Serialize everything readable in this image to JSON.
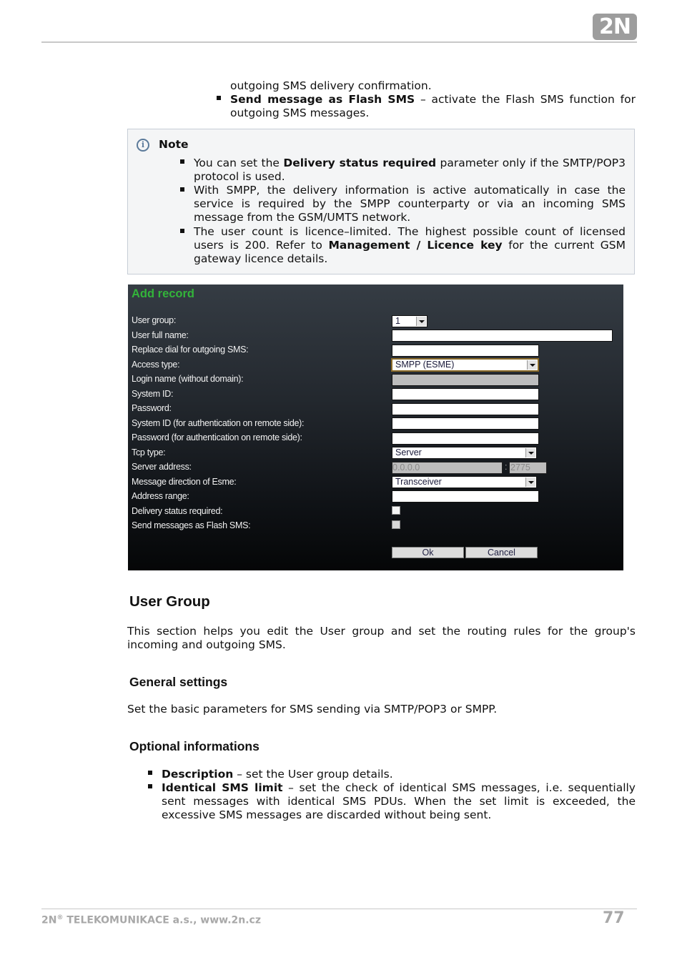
{
  "header": {
    "logo_text": "2N"
  },
  "intro": {
    "continuation": "outgoing SMS delivery confirmation.",
    "bullet_bold": "Send message as Flash SMS",
    "bullet_rest": " – activate the Flash SMS function for outgoing SMS messages."
  },
  "note": {
    "title": "Note",
    "icon": "info-icon",
    "items": [
      {
        "pre": "You can set the ",
        "bold": "Delivery status required",
        "post": " parameter only if the SMTP/POP3 protocol is used."
      },
      {
        "pre": "With SMPP, the delivery information is active automatically in case the service is required by the SMPP counterparty or via an incoming SMS message from the GSM/UMTS network.",
        "bold": "",
        "post": ""
      },
      {
        "pre": "The user count is licence–limited. The highest possible count of licensed users is 200. Refer to ",
        "bold": "Management / Licence key",
        "post": " for the current GSM gateway licence details."
      }
    ]
  },
  "form": {
    "title": "Add record",
    "accent_color": "#33b43a",
    "fields": {
      "user_group": {
        "label": "User group:",
        "value": "1"
      },
      "user_full_name": {
        "label": "User full name:",
        "value": ""
      },
      "replace_dial": {
        "label": "Replace dial for outgoing SMS:",
        "value": ""
      },
      "access_type": {
        "label": "Access type:",
        "value": "SMPP (ESME)"
      },
      "login_name": {
        "label": "Login name (without domain):",
        "value": ""
      },
      "system_id": {
        "label": "System ID:",
        "value": ""
      },
      "password": {
        "label": "Password:",
        "value": ""
      },
      "system_id_remote": {
        "label": "System ID (for authentication on remote side):",
        "value": ""
      },
      "password_remote": {
        "label": "Password (for authentication on remote side):",
        "value": ""
      },
      "tcp_type": {
        "label": "Tcp type:",
        "value": "Server"
      },
      "server_address": {
        "label": "Server address:",
        "ip": "0.0.0.0",
        "separator": ":",
        "port": "2775"
      },
      "message_direction": {
        "label": "Message direction of Esme:",
        "value": "Transceiver"
      },
      "address_range": {
        "label": "Address range:",
        "value": ""
      },
      "delivery_status": {
        "label": "Delivery status required:",
        "checked": false
      },
      "flash_sms": {
        "label": "Send messages as Flash SMS:",
        "checked": false
      }
    },
    "buttons": {
      "ok": "Ok",
      "cancel": "Cancel"
    }
  },
  "user_group": {
    "heading": "User Group",
    "description": "This section helps you edit the User group and set the routing rules for the group's incoming and outgoing SMS."
  },
  "general_settings": {
    "heading": "General settings",
    "text": "Set the basic parameters for SMS sending via SMTP/POP3 or SMPP."
  },
  "optional_informations": {
    "heading": "Optional informations",
    "items": [
      {
        "bold": "Description",
        "rest": " – set the User group details."
      },
      {
        "bold": "Identical SMS limit",
        "rest": " – set the check of identical SMS messages, i.e. sequentially sent messages with identical SMS PDUs. When the set limit is exceeded, the excessive SMS messages are discarded without being sent."
      }
    ]
  },
  "footer": {
    "company": "2N",
    "registered": "®",
    "company_rest": " TELEKOMUNIKACE a.s., www.2n.cz",
    "page_number": "77"
  }
}
